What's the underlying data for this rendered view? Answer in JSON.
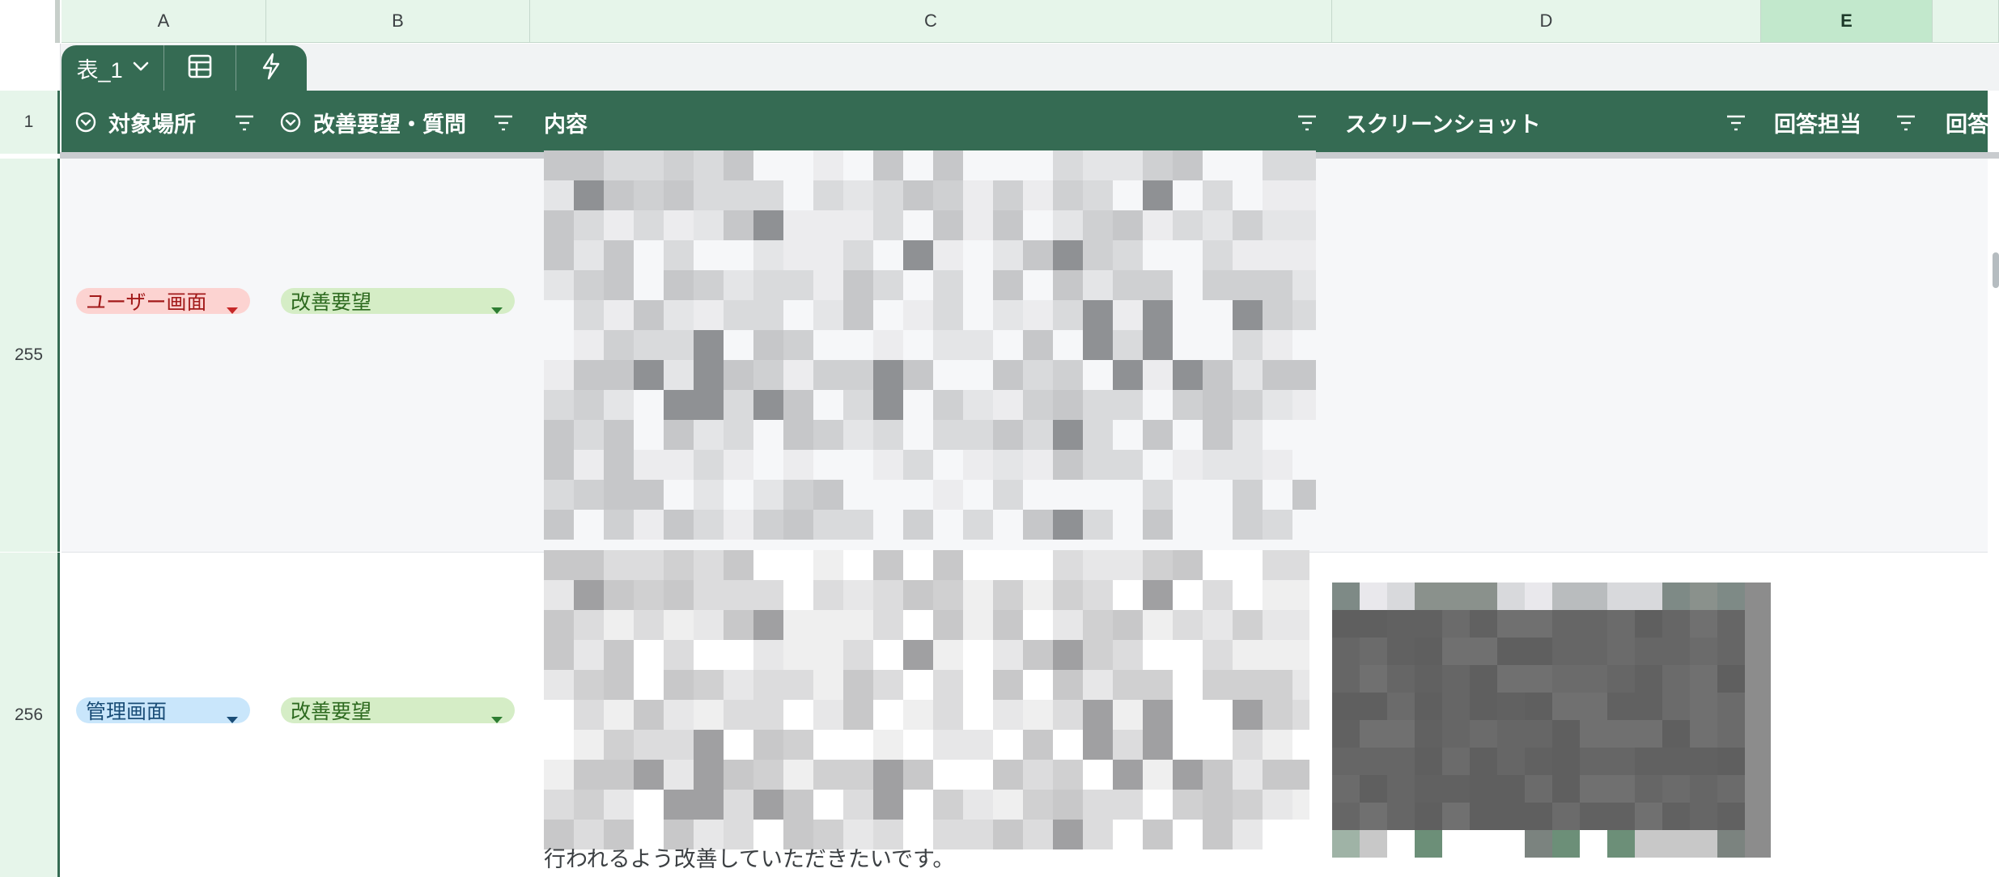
{
  "columns": {
    "a": "A",
    "b": "B",
    "c": "C",
    "d": "D",
    "e": "E"
  },
  "table_tab": {
    "name": "表_1",
    "icons": [
      "chevron-down-icon",
      "calculator-icon",
      "lightning-icon"
    ]
  },
  "header_row": {
    "row_number": "1",
    "cells": {
      "target_location": "対象場所",
      "request_type": "改善要望・質問",
      "content": "内容",
      "screenshot": "スクリーンショット",
      "responder": "回答担当",
      "response_cut": "回答"
    }
  },
  "rows": [
    {
      "row_number": "255",
      "target_location": "ユーザー画面",
      "request_type": "改善要望"
    },
    {
      "row_number": "256",
      "target_location": "管理画面",
      "request_type": "改善要望",
      "content_visible_tail": "行われるよう改善していただきたいです。"
    }
  ],
  "colors": {
    "header_green": "#356b53",
    "column_header_bg": "#e6f5ea",
    "chip_red_bg": "#fcd3d1",
    "chip_blue_bg": "#c9e6fb",
    "chip_green_bg": "#d5edc6"
  }
}
